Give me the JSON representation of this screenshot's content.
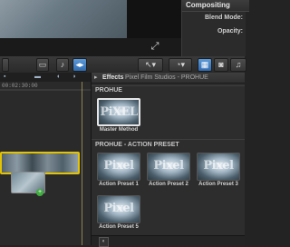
{
  "inspector": {
    "section": "Compositing",
    "blend_mode_label": "Blend Mode:",
    "opacity_label": "Opacity:"
  },
  "viewer": {
    "fullscreen_icon": "expand-arrows-icon"
  },
  "timeline": {
    "timecode": "00:02:30:00"
  },
  "effects_browser": {
    "title": "Effects",
    "subtitle": "Pixel Film Studios - PROHUE",
    "sections": [
      {
        "title": "PROHUE",
        "items": [
          {
            "label": "Master Method"
          }
        ]
      },
      {
        "title": "PROHUE - ACTION PRESET",
        "items": [
          {
            "label": "Action Preset 1"
          },
          {
            "label": "Action Preset 2"
          },
          {
            "label": "Action Preset 3"
          },
          {
            "label": "Action Preset 5"
          }
        ]
      }
    ]
  },
  "colors": {
    "accent_yellow": "#e4c300",
    "active_blue": "#2f6bb0",
    "badge_green": "#3fae3f"
  }
}
